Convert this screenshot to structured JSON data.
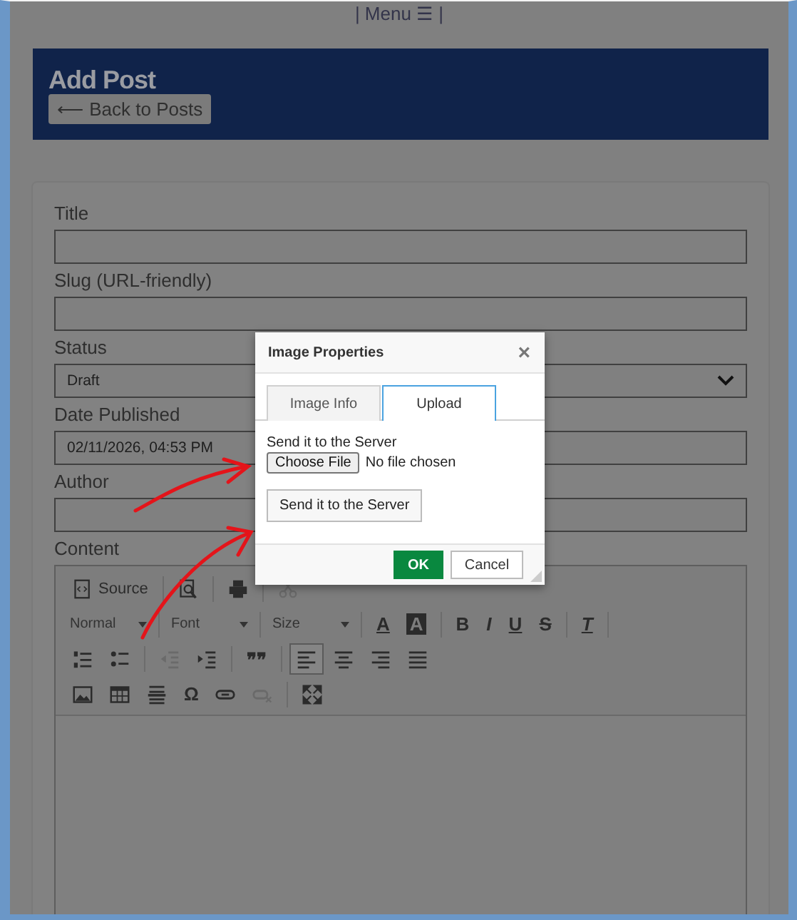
{
  "menu": "| Menu ☰ |",
  "header": {
    "title": "Add Post",
    "back_button": "⟵ Back to Posts"
  },
  "form": {
    "fields": [
      {
        "label": "Title",
        "kind": "text"
      },
      {
        "label": "Slug (URL-friendly)",
        "kind": "text"
      },
      {
        "label": "Status",
        "kind": "select",
        "value": "Draft"
      },
      {
        "label": "Date Published",
        "kind": "text",
        "value": "02/11/2026, 04:53 PM"
      },
      {
        "label": "Author",
        "kind": "text"
      }
    ],
    "content_label": "Content"
  },
  "editor": {
    "toolbar_rows": [
      [
        {
          "kind": "source",
          "label": "Source",
          "disabled": false,
          "selected": false
        },
        {
          "kind": "separator"
        },
        {
          "kind": "preview",
          "disabled": false,
          "selected": false
        },
        {
          "kind": "separator"
        },
        {
          "kind": "print",
          "disabled": false,
          "selected": false
        },
        {
          "kind": "separator"
        },
        {
          "kind": "cut",
          "disabled": true,
          "selected": false
        }
      ],
      [
        {
          "kind": "combo",
          "label": "Normal"
        },
        {
          "kind": "separator"
        },
        {
          "kind": "combo",
          "label": "Font"
        },
        {
          "kind": "separator"
        },
        {
          "kind": "combo",
          "label": "Size"
        },
        {
          "kind": "separator"
        },
        {
          "kind": "textcolor",
          "label": "A",
          "disabled": false,
          "selected": false
        },
        {
          "kind": "bgcolor",
          "label": "A",
          "disabled": false,
          "selected": false
        },
        {
          "kind": "separator"
        },
        {
          "kind": "bold",
          "label": "B",
          "disabled": false,
          "selected": false
        },
        {
          "kind": "italic",
          "label": "I",
          "disabled": false,
          "selected": false
        },
        {
          "kind": "underline",
          "label": "U",
          "disabled": false,
          "selected": false
        },
        {
          "kind": "strike",
          "label": "S",
          "disabled": false,
          "selected": false
        },
        {
          "kind": "separator"
        },
        {
          "kind": "clearformat",
          "label": "T",
          "disabled": false,
          "selected": false
        },
        {
          "kind": "separator"
        }
      ],
      [
        {
          "kind": "numbered",
          "disabled": false,
          "selected": false
        },
        {
          "kind": "bulleted",
          "disabled": false,
          "selected": false
        },
        {
          "kind": "separator"
        },
        {
          "kind": "outdent",
          "disabled": true,
          "selected": false
        },
        {
          "kind": "indent",
          "disabled": false,
          "selected": false
        },
        {
          "kind": "separator"
        },
        {
          "kind": "quote",
          "label": "❞❞",
          "disabled": false,
          "selected": false
        },
        {
          "kind": "separator"
        },
        {
          "kind": "alignleft",
          "disabled": false,
          "selected": true
        },
        {
          "kind": "aligncenter",
          "disabled": false,
          "selected": false
        },
        {
          "kind": "alignright",
          "disabled": false,
          "selected": false
        },
        {
          "kind": "justify",
          "disabled": false,
          "selected": false
        }
      ],
      [
        {
          "kind": "image",
          "disabled": false,
          "selected": false
        },
        {
          "kind": "table",
          "disabled": false,
          "selected": false
        },
        {
          "kind": "rule",
          "disabled": false,
          "selected": false
        },
        {
          "kind": "symbol",
          "label": "Ω",
          "disabled": false,
          "selected": false
        },
        {
          "kind": "link",
          "disabled": false,
          "selected": false
        },
        {
          "kind": "unlink",
          "disabled": true,
          "selected": false
        },
        {
          "kind": "separator"
        },
        {
          "kind": "maximize",
          "disabled": false,
          "selected": false
        }
      ]
    ]
  },
  "dialog": {
    "title": "Image Properties",
    "close": "×",
    "tabs": [
      {
        "label": "Image Info",
        "selected": false
      },
      {
        "label": "Upload",
        "selected": true
      }
    ],
    "upload_label": "Send it to the Server",
    "file_button": "Choose File",
    "file_status": "No file chosen",
    "send_button": "Send it to the Server",
    "ok_button": "OK",
    "cancel_button": "Cancel"
  }
}
